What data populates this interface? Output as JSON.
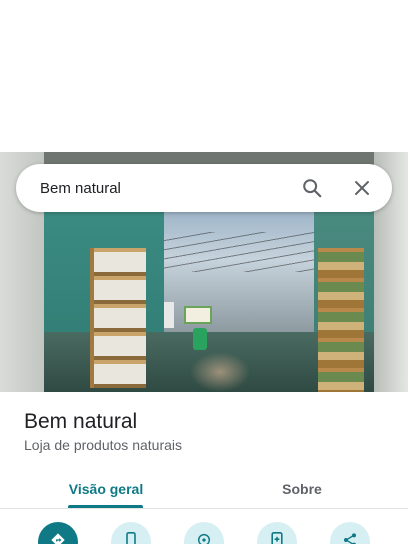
{
  "search": {
    "query": "Bem natural"
  },
  "icons": {
    "search": "search-icon",
    "close": "close-icon"
  },
  "place": {
    "title": "Bem natural",
    "category": "Loja de produtos naturais"
  },
  "tabs": [
    {
      "label": "Visão geral",
      "selected": true
    },
    {
      "label": "Sobre",
      "selected": false
    }
  ],
  "actions": [
    {
      "icon": "directions-icon",
      "primary": true
    },
    {
      "icon": "phone-icon",
      "primary": false
    },
    {
      "icon": "navigate-icon",
      "primary": false
    },
    {
      "icon": "save-icon",
      "primary": false
    },
    {
      "icon": "share-icon",
      "primary": false
    }
  ],
  "colors": {
    "accent": "#0f7a86",
    "action_bg": "#d6eff2"
  }
}
